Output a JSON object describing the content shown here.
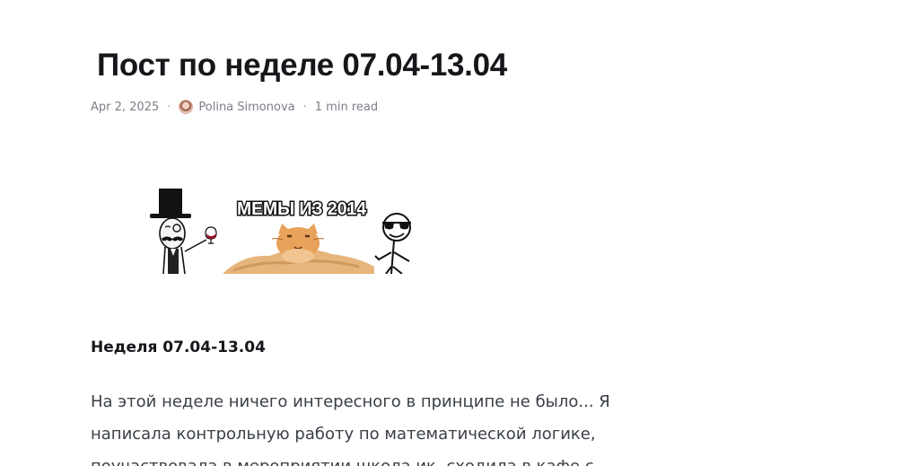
{
  "post": {
    "title": "Пост по неделе 07.04-13.04",
    "date": "Apr 2, 2025",
    "separator": "·",
    "author": "Polina Simonova",
    "read_time": "1 min read",
    "author_avatar_icon": "avatar-icon"
  },
  "feature_image": {
    "caption_text": "МЕМЫ ИЗ 2014",
    "elements": [
      "gentleman-meme-icon",
      "cat-meme-icon",
      "cool-stickman-icon"
    ]
  },
  "content": {
    "heading": "Неделя 07.04-13.04",
    "paragraph": "На этой неделе ничего интересного в принципе не было... Я написала контрольную работу по математической логике, поучаствовала в мероприятии школа ик, сходила в кафе с"
  }
}
